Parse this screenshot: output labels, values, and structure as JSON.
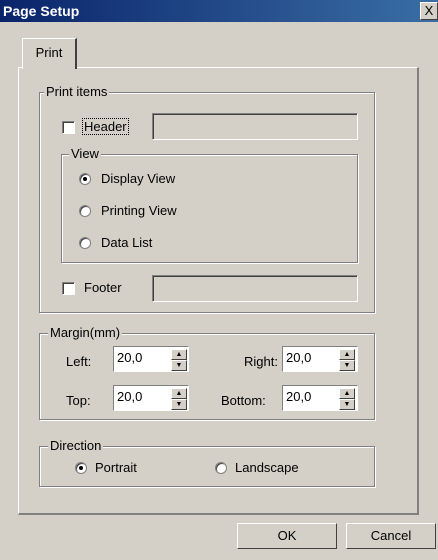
{
  "window": {
    "title": "Page Setup",
    "close_label": "X"
  },
  "tabs": [
    {
      "label": "Print"
    }
  ],
  "print_items": {
    "legend": "Print items",
    "header": {
      "label": "Header",
      "checked": false,
      "value": ""
    },
    "view": {
      "legend": "View",
      "options": [
        {
          "label": "Display View",
          "selected": true
        },
        {
          "label": "Printing View",
          "selected": false
        },
        {
          "label": "Data List",
          "selected": false
        }
      ]
    },
    "footer": {
      "label": "Footer",
      "checked": false,
      "value": ""
    }
  },
  "margin": {
    "legend": "Margin(mm)",
    "left": {
      "label": "Left:",
      "value": "20,0"
    },
    "right": {
      "label": "Right:",
      "value": "20,0"
    },
    "top": {
      "label": "Top:",
      "value": "20,0"
    },
    "bottom": {
      "label": "Bottom:",
      "value": "20,0"
    }
  },
  "direction": {
    "legend": "Direction",
    "options": [
      {
        "label": "Portrait",
        "selected": true
      },
      {
        "label": "Landscape",
        "selected": false
      }
    ]
  },
  "buttons": {
    "ok": "OK",
    "cancel": "Cancel"
  }
}
